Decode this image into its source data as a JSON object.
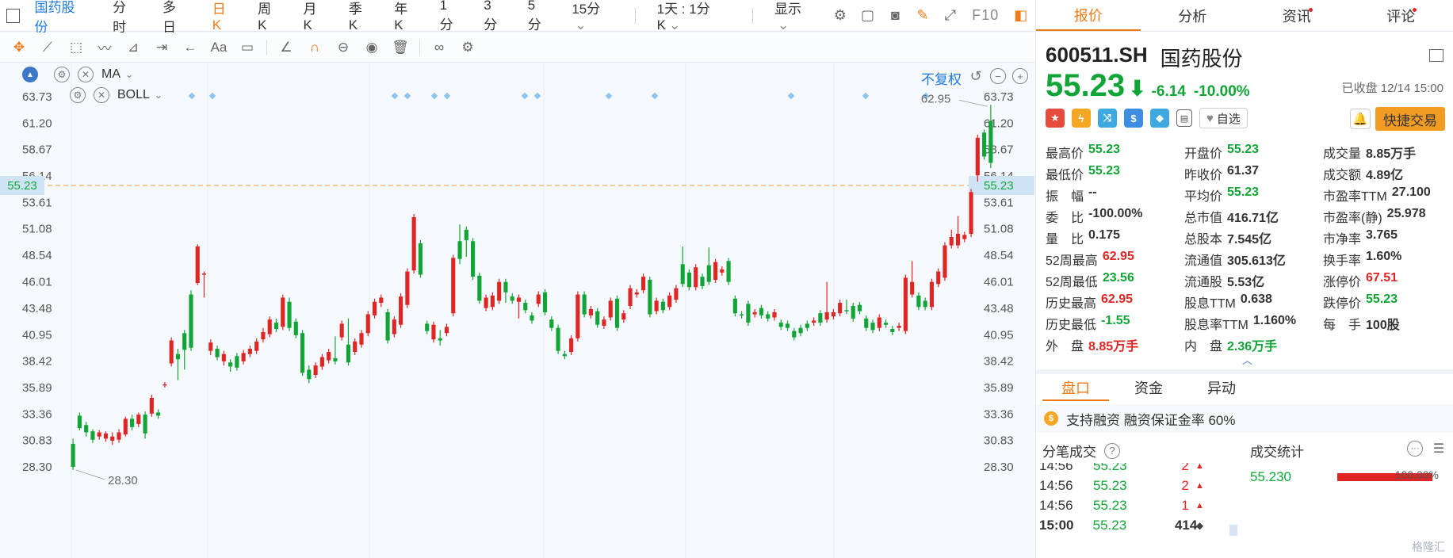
{
  "topbar": {
    "stock_name": "国药股份",
    "periods": [
      "分时",
      "多日",
      "日K",
      "周K",
      "月K",
      "季K",
      "年K",
      "1分",
      "3分",
      "5分",
      "15分"
    ],
    "active_period": "日K",
    "range_select": "1天 : 1分K",
    "display_label": "显示",
    "f10_label": "F10"
  },
  "chart": {
    "indicator_1": "MA",
    "indicator_2": "BOLL",
    "adjust_label": "不复权",
    "max_label": "62.95",
    "min_label": "28.30",
    "current_price_tag": "55.23",
    "y_ticks": [
      "63.73",
      "61.20",
      "58.67",
      "56.14",
      "53.61",
      "51.08",
      "48.54",
      "46.01",
      "43.48",
      "40.95",
      "38.42",
      "35.89",
      "33.36",
      "30.83",
      "28.30"
    ]
  },
  "chart_data": {
    "type": "candlestick",
    "ylim": [
      28.3,
      63.73
    ],
    "current_price": 55.23,
    "period_high": 62.95,
    "period_low": 28.3,
    "candles": [
      [
        30.5,
        28.3,
        31.0,
        28.0
      ],
      [
        33.2,
        32.0,
        33.5,
        31.8
      ],
      [
        32.3,
        31.6,
        32.6,
        31.2
      ],
      [
        31.7,
        30.9,
        31.9,
        30.6
      ],
      [
        31.2,
        31.6,
        31.8,
        30.9
      ],
      [
        31.0,
        31.5,
        31.7,
        30.7
      ],
      [
        30.8,
        31.2,
        31.6,
        30.4
      ],
      [
        30.9,
        31.6,
        31.9,
        30.6
      ],
      [
        31.4,
        32.9,
        33.1,
        31.2
      ],
      [
        32.9,
        32.1,
        33.3,
        31.8
      ],
      [
        32.4,
        33.3,
        33.5,
        32.1
      ],
      [
        33.3,
        31.5,
        33.6,
        31.0
      ],
      [
        33.4,
        34.9,
        35.2,
        33.1
      ],
      [
        33.5,
        33.2,
        33.8,
        32.9
      ],
      [
        36.2,
        36.2,
        36.4,
        35.9
      ],
      [
        38.2,
        40.4,
        40.7,
        37.9
      ],
      [
        39.1,
        38.6,
        39.6,
        36.6
      ],
      [
        41.1,
        39.5,
        41.4,
        37.6
      ],
      [
        44.8,
        39.7,
        45.2,
        39.4
      ],
      [
        45.9,
        49.4,
        49.6,
        45.7
      ],
      [
        46.8,
        46.8,
        47.0,
        44.5
      ],
      [
        39.4,
        40.2,
        40.5,
        39.0
      ],
      [
        39.6,
        38.8,
        39.9,
        38.5
      ],
      [
        38.4,
        39.1,
        39.4,
        38.0
      ],
      [
        38.3,
        37.9,
        38.6,
        37.4
      ],
      [
        38.9,
        37.8,
        39.2,
        37.5
      ],
      [
        38.4,
        39.2,
        39.5,
        38.1
      ],
      [
        39.1,
        39.6,
        39.9,
        38.8
      ],
      [
        39.4,
        40.3,
        40.6,
        39.1
      ],
      [
        40.5,
        41.2,
        41.6,
        40.2
      ],
      [
        41.0,
        42.4,
        42.7,
        40.7
      ],
      [
        42.1,
        41.5,
        42.5,
        41.2
      ],
      [
        41.7,
        44.5,
        44.8,
        41.4
      ],
      [
        44.1,
        41.6,
        44.5,
        41.3
      ],
      [
        42.2,
        40.9,
        42.5,
        40.6
      ],
      [
        41.1,
        37.3,
        41.4,
        37.0
      ],
      [
        37.6,
        36.7,
        38.0,
        36.3
      ],
      [
        37.1,
        38.0,
        38.3,
        36.8
      ],
      [
        37.9,
        38.8,
        39.1,
        37.6
      ],
      [
        38.5,
        39.3,
        39.6,
        38.2
      ],
      [
        38.7,
        38.4,
        40.8,
        38.1
      ],
      [
        40.7,
        42.0,
        42.3,
        40.4
      ],
      [
        40.0,
        38.3,
        42.5,
        38.0
      ],
      [
        39.3,
        40.3,
        40.6,
        39.0
      ],
      [
        40.0,
        41.1,
        41.4,
        39.7
      ],
      [
        41.1,
        42.9,
        43.2,
        40.8
      ],
      [
        42.8,
        44.1,
        44.4,
        42.5
      ],
      [
        44.0,
        44.5,
        44.8,
        43.6
      ],
      [
        43.1,
        40.4,
        43.4,
        40.1
      ],
      [
        41.0,
        42.4,
        42.7,
        40.7
      ],
      [
        41.9,
        44.6,
        44.9,
        41.6
      ],
      [
        43.8,
        47.0,
        47.3,
        43.5
      ],
      [
        47.1,
        52.2,
        52.5,
        46.8
      ],
      [
        49.7,
        46.7,
        50.0,
        46.4
      ],
      [
        42.0,
        41.3,
        42.3,
        41.0
      ],
      [
        40.5,
        41.9,
        42.2,
        40.2
      ],
      [
        40.6,
        40.4,
        41.4,
        39.9
      ],
      [
        41.1,
        41.7,
        42.0,
        40.8
      ],
      [
        43.0,
        48.3,
        48.6,
        42.7
      ],
      [
        49.9,
        48.2,
        51.5,
        47.7
      ],
      [
        51.0,
        50.0,
        51.3,
        48.4
      ],
      [
        49.9,
        46.5,
        50.2,
        46.2
      ],
      [
        46.6,
        44.2,
        46.9,
        43.9
      ],
      [
        43.5,
        44.5,
        44.8,
        43.2
      ],
      [
        43.6,
        44.7,
        45.0,
        43.3
      ],
      [
        44.2,
        46.0,
        46.3,
        43.9
      ],
      [
        46.0,
        45.0,
        46.3,
        44.0
      ],
      [
        44.6,
        44.2,
        44.9,
        43.9
      ],
      [
        44.1,
        44.5,
        44.8,
        42.5
      ],
      [
        44.0,
        43.3,
        44.3,
        43.0
      ],
      [
        42.8,
        42.3,
        43.1,
        42.0
      ],
      [
        43.9,
        44.8,
        45.1,
        43.6
      ],
      [
        45.0,
        43.1,
        45.3,
        42.8
      ],
      [
        42.4,
        41.6,
        42.7,
        41.3
      ],
      [
        41.6,
        39.4,
        41.9,
        39.1
      ],
      [
        39.1,
        38.9,
        39.4,
        38.6
      ],
      [
        39.3,
        40.6,
        40.9,
        39.0
      ],
      [
        40.6,
        44.8,
        45.1,
        40.3
      ],
      [
        44.8,
        42.9,
        45.1,
        42.6
      ],
      [
        42.8,
        43.4,
        43.7,
        42.5
      ],
      [
        43.2,
        41.9,
        43.5,
        41.6
      ],
      [
        41.8,
        42.4,
        42.7,
        41.5
      ],
      [
        42.6,
        44.2,
        44.5,
        42.3
      ],
      [
        44.4,
        41.6,
        44.7,
        41.3
      ],
      [
        42.4,
        43.0,
        43.3,
        42.1
      ],
      [
        43.7,
        45.4,
        45.7,
        43.4
      ],
      [
        44.8,
        45.0,
        45.3,
        44.5
      ],
      [
        45.2,
        46.5,
        46.8,
        44.9
      ],
      [
        46.2,
        42.9,
        46.5,
        42.6
      ],
      [
        43.2,
        44.2,
        44.5,
        42.9
      ],
      [
        44.1,
        43.3,
        44.4,
        43.0
      ],
      [
        43.6,
        44.7,
        45.0,
        43.3
      ],
      [
        44.3,
        45.4,
        45.7,
        44.0
      ],
      [
        47.7,
        45.8,
        49.4,
        45.5
      ],
      [
        46.9,
        45.5,
        47.2,
        45.2
      ],
      [
        45.5,
        47.4,
        47.7,
        45.2
      ],
      [
        46.5,
        45.6,
        46.8,
        45.3
      ],
      [
        47.6,
        46.0,
        49.3,
        45.7
      ],
      [
        46.2,
        47.9,
        48.2,
        45.9
      ],
      [
        46.9,
        47.2,
        47.5,
        46.6
      ],
      [
        48.0,
        46.0,
        48.3,
        45.7
      ],
      [
        44.4,
        43.0,
        44.7,
        42.7
      ],
      [
        42.9,
        42.8,
        43.2,
        42.5
      ],
      [
        43.9,
        42.1,
        44.2,
        41.8
      ],
      [
        42.9,
        43.1,
        43.4,
        42.6
      ],
      [
        43.5,
        42.8,
        43.8,
        42.5
      ],
      [
        42.9,
        42.5,
        43.2,
        42.2
      ],
      [
        42.6,
        43.1,
        43.4,
        42.3
      ],
      [
        42.1,
        41.7,
        42.4,
        41.4
      ],
      [
        42.0,
        41.6,
        42.3,
        41.3
      ],
      [
        41.3,
        40.7,
        41.6,
        40.4
      ],
      [
        41.6,
        41.1,
        41.9,
        40.8
      ],
      [
        42.0,
        41.6,
        42.3,
        41.3
      ],
      [
        42.1,
        42.3,
        42.6,
        41.8
      ],
      [
        43.0,
        42.1,
        43.3,
        41.8
      ],
      [
        42.4,
        43.1,
        46.0,
        42.1
      ],
      [
        42.7,
        43.1,
        43.4,
        42.4
      ],
      [
        43.0,
        44.0,
        44.3,
        42.7
      ],
      [
        43.3,
        43.2,
        44.3,
        42.9
      ],
      [
        43.7,
        42.5,
        44.0,
        42.2
      ],
      [
        43.8,
        43.2,
        44.1,
        42.9
      ],
      [
        42.5,
        41.6,
        42.8,
        41.3
      ],
      [
        42.1,
        41.4,
        42.4,
        41.1
      ],
      [
        41.6,
        42.6,
        42.9,
        41.3
      ],
      [
        42.1,
        41.9,
        42.4,
        41.6
      ],
      [
        41.5,
        41.2,
        41.8,
        40.9
      ],
      [
        41.6,
        41.8,
        42.1,
        41.3
      ],
      [
        41.3,
        46.4,
        46.7,
        41.0
      ],
      [
        44.8,
        46.0,
        48.0,
        44.5
      ],
      [
        44.7,
        43.6,
        45.0,
        43.3
      ],
      [
        44.2,
        43.6,
        44.5,
        43.3
      ],
      [
        43.6,
        46.0,
        46.3,
        43.3
      ],
      [
        45.8,
        47.0,
        47.3,
        45.5
      ],
      [
        46.4,
        49.5,
        49.8,
        46.1
      ],
      [
        49.5,
        50.3,
        51.0,
        49.2
      ],
      [
        49.5,
        50.6,
        52.3,
        49.2
      ],
      [
        50.1,
        50.5,
        50.8,
        49.8
      ],
      [
        50.6,
        54.6,
        54.9,
        50.3
      ],
      [
        56.2,
        59.8,
        60.1,
        55.6
      ],
      [
        60.3,
        58.0,
        60.6,
        57.7
      ],
      [
        61.4,
        57.4,
        62.95,
        56.9
      ]
    ]
  },
  "quote": {
    "tabs": [
      "报价",
      "分析",
      "资讯",
      "评论"
    ],
    "code": "600511.SH",
    "name": "国药股份",
    "price": "55.23",
    "arrow": "⬇",
    "change": "-6.14",
    "change_pct": "-10.00%",
    "status": "已收盘 12/14 15:00",
    "watch_label": "自选",
    "trade_label": "快捷交易",
    "stats": [
      [
        {
          "k": "最高价",
          "v": "55.23",
          "c": "g"
        },
        {
          "k": "开盘价",
          "v": "55.23",
          "c": "g"
        },
        {
          "k": "成交量",
          "v": "8.85万手",
          "c": ""
        }
      ],
      [
        {
          "k": "最低价",
          "v": "55.23",
          "c": "g"
        },
        {
          "k": "昨收价",
          "v": "61.37",
          "c": ""
        },
        {
          "k": "成交额",
          "v": "4.89亿",
          "c": ""
        }
      ],
      [
        {
          "k": "振　幅",
          "v": "--",
          "c": ""
        },
        {
          "k": "平均价",
          "v": "55.23",
          "c": "g"
        },
        {
          "k": "市盈率TTM",
          "v": "27.100",
          "c": ""
        }
      ],
      [
        {
          "k": "委　比",
          "v": "-100.00%",
          "c": ""
        },
        {
          "k": "总市值",
          "v": "416.71亿",
          "c": ""
        },
        {
          "k": "市盈率(静)",
          "v": "25.978",
          "c": ""
        }
      ],
      [
        {
          "k": "量　比",
          "v": "0.175",
          "c": ""
        },
        {
          "k": "总股本",
          "v": "7.545亿",
          "c": ""
        },
        {
          "k": "市净率",
          "v": "3.765",
          "c": ""
        }
      ],
      [
        {
          "k": "52周最高",
          "v": "62.95",
          "c": "r"
        },
        {
          "k": "流通值",
          "v": "305.613亿",
          "c": ""
        },
        {
          "k": "换手率",
          "v": "1.60%",
          "c": ""
        }
      ],
      [
        {
          "k": "52周最低",
          "v": "23.56",
          "c": "g"
        },
        {
          "k": "流通股",
          "v": "5.53亿",
          "c": ""
        },
        {
          "k": "涨停价",
          "v": "67.51",
          "c": "r"
        }
      ],
      [
        {
          "k": "历史最高",
          "v": "62.95",
          "c": "r"
        },
        {
          "k": "股息TTM",
          "v": "0.638",
          "c": ""
        },
        {
          "k": "跌停价",
          "v": "55.23",
          "c": "g"
        }
      ],
      [
        {
          "k": "历史最低",
          "v": "-1.55",
          "c": "g"
        },
        {
          "k": "股息率TTM",
          "v": "1.160%",
          "c": ""
        },
        {
          "k": "每　手",
          "v": "100股",
          "c": ""
        }
      ],
      [
        {
          "k": "外　盘",
          "v": "8.85万手",
          "c": "r"
        },
        {
          "k": "内　盘",
          "v": "2.36万手",
          "c": "g"
        },
        {
          "k": "",
          "v": "",
          "c": ""
        }
      ]
    ],
    "subtabs": [
      "盘口",
      "资金",
      "异动"
    ],
    "margin_text": "支持融资  融资保证金率 60%",
    "ticks_title": "分笔成交",
    "ticks": [
      {
        "t": "14:56",
        "p": "55.23",
        "q": "2",
        "d": "▲"
      },
      {
        "t": "14:56",
        "p": "55.23",
        "q": "2",
        "d": "▲"
      },
      {
        "t": "14:56",
        "p": "55.23",
        "q": "1",
        "d": "▲"
      },
      {
        "t": "15:00",
        "p": "55.23",
        "q": "414",
        "d": "◆"
      }
    ],
    "vol_title": "成交统计",
    "vol_price": "55.230",
    "vol_pct": "100.00%",
    "watermark": "格隆汇"
  }
}
